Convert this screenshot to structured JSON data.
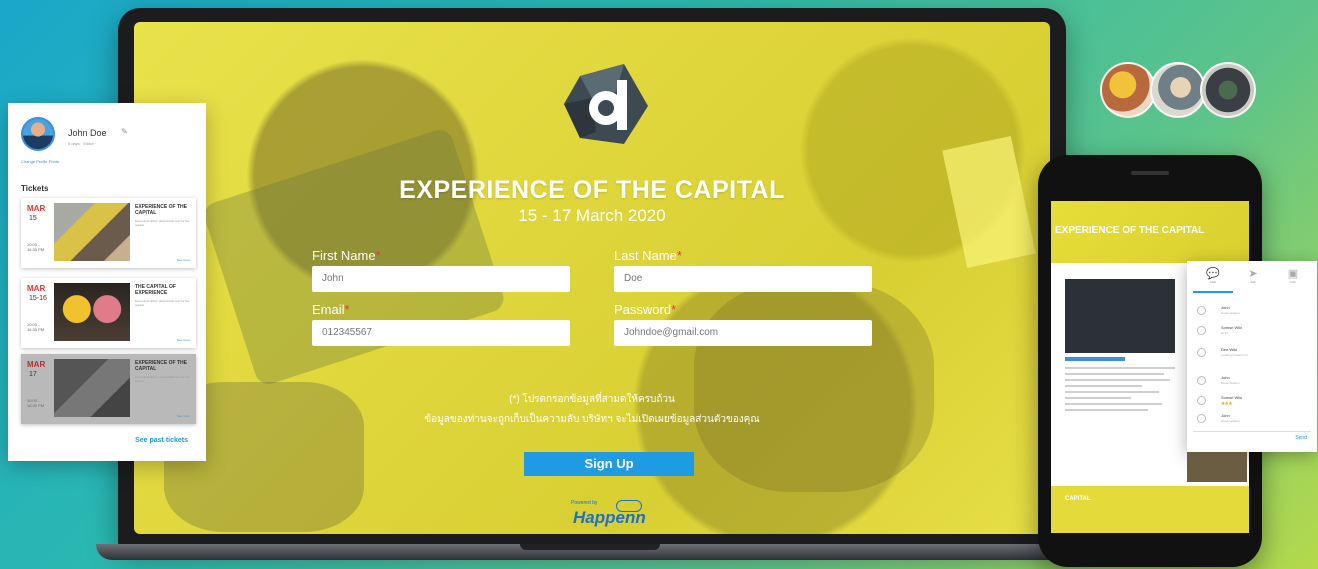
{
  "event": {
    "title": "EXPERIENCE OF THE CAPITAL",
    "date": "15 - 17 March 2020"
  },
  "form": {
    "first_name_label": "First Name",
    "last_name_label": "Last Name",
    "email_label": "Email",
    "password_label": "Password",
    "required_mark": "*",
    "first_name_value": "John",
    "last_name_value": "Doe",
    "email_value": "012345567",
    "password_value": "Johndoe@gmail.com",
    "notice_line1": "(*) โปรดกรอกข้อมูลที่สามดให้ครบถ้วน",
    "notice_line2": "ข้อมูลของท่านจะถูกเก็บเป็นความลับ บริษัทฯ จะไม่เปิดเผยข้อมูลส่วนตัวของคุณ",
    "signup_label": "Sign Up"
  },
  "powered": {
    "small": "Powered by",
    "brand": "Happenn"
  },
  "ticket_panel": {
    "user_name": "John Doe",
    "user_meta": "5 days  ·  Editor  ·",
    "change_photo": "Change Profile Photo",
    "heading": "Tickets",
    "see_past": "See past tickets",
    "tickets": [
      {
        "month": "MAR",
        "day": "15",
        "time": "10:00 - 16:30 PM",
        "title": "EXPERIENCE OF THE CAPITAL",
        "desc": "Event description placeholder text for the capital",
        "more": "See more"
      },
      {
        "month": "MAR",
        "day": "15-16",
        "time": "10:00 - 16:30 PM",
        "title": "THE CAPITAL OF EXPERIENCE",
        "desc": "Event description placeholder text for the capital",
        "more": "See more"
      },
      {
        "month": "MAR",
        "day": "17",
        "time": "10:00 - 16:30 PM",
        "title": "EXPERIENCE OF THE CAPITAL",
        "desc": "Event description placeholder text for the capital",
        "more": "See more"
      }
    ]
  },
  "phone": {
    "title": "EXPERIENCE OF THE CAPITAL",
    "footer_logo": "CAPITAL"
  },
  "chat": {
    "tabs": [
      "Chat",
      "Ask",
      "Info"
    ],
    "items": [
      {
        "name": "John",
        "msg": "Great session"
      },
      {
        "name": "Somsri Wiki",
        "msg": "Hi all"
      },
      {
        "name": "Dee Wiki",
        "msg": "Looking forward to it"
      },
      {
        "name": "John",
        "msg": "Great session"
      },
      {
        "name": "Somsri Wiki",
        "msg": "👍👍👍"
      },
      {
        "name": "John",
        "msg": "Great session"
      }
    ],
    "send": "Send"
  }
}
